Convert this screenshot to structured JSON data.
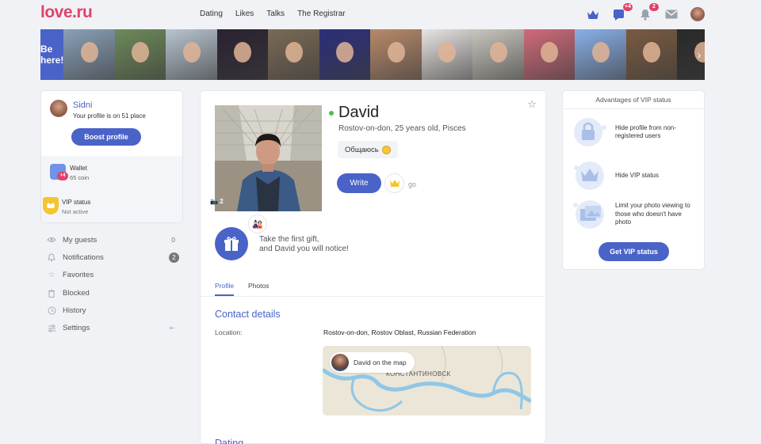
{
  "header": {
    "logo": "love.ru",
    "nav": [
      "Dating",
      "Likes",
      "Talks",
      "The Registrar"
    ],
    "messages_badge": "+4",
    "notifications_badge": "2"
  },
  "strip": {
    "cta": "Be here!",
    "photos": [
      "#8aa0b8",
      "#6d8a5a",
      "#b8c4d0",
      "#2a2230",
      "#7a6a55",
      "#2b2f7a",
      "#b88a6a",
      "#e8e4e2",
      "#c8c6be",
      "#d06a7a",
      "#8ab0e8",
      "#7a5a40",
      "#2a2a2a"
    ],
    "arrow": "›"
  },
  "profile_card": {
    "name": "Sidni",
    "place_text": "Your profile is on 51 place",
    "boost_label": "Boost profile",
    "wallet_label": "Wallet",
    "wallet_badge": "+4",
    "wallet_amount": "65 coin",
    "vip_label": "VIP status",
    "vip_state": "Not active"
  },
  "menu": [
    {
      "label": "My guests",
      "value": "0",
      "icon": "eye-icon"
    },
    {
      "label": "Notifications",
      "value": "2",
      "icon": "bell-icon"
    },
    {
      "label": "Favorites",
      "icon": "star-icon"
    },
    {
      "label": "Blocked",
      "icon": "trash-icon"
    },
    {
      "label": "History",
      "icon": "clock-icon"
    },
    {
      "label": "Settings",
      "icon": "settings-icon",
      "extra": "⇤"
    }
  ],
  "user": {
    "name": "David",
    "subtitle": "Rostov-on-don, 25 years old, Pisces",
    "status": "Общаюсь",
    "photo_count": "2",
    "write_label": "Write",
    "go_label": "go",
    "gift_text_1": "Take the first gift,",
    "gift_text_2": "and David you will notice!"
  },
  "tabs": [
    "Profile",
    "Photos"
  ],
  "contact": {
    "title": "Contact details",
    "location_label": "Location:",
    "location_value": "Rostov-on-don, Rostov Oblast, Russian Federation",
    "map_pill": "David on the map",
    "map_city": "КОНСТАНТИНОВСК"
  },
  "dating_title": "Dating",
  "vip": {
    "title": "Advantages of VIP status",
    "items": [
      "Hide profile from non-registered users",
      "Hide VIP status",
      "Limit your photo viewing to those who doesn't have photo"
    ],
    "cta": "Get VIP status"
  },
  "colors": {
    "accent": "#4a63c8",
    "brand": "#e2416b",
    "online": "#4cbe4a",
    "vip": "#f5c530"
  }
}
